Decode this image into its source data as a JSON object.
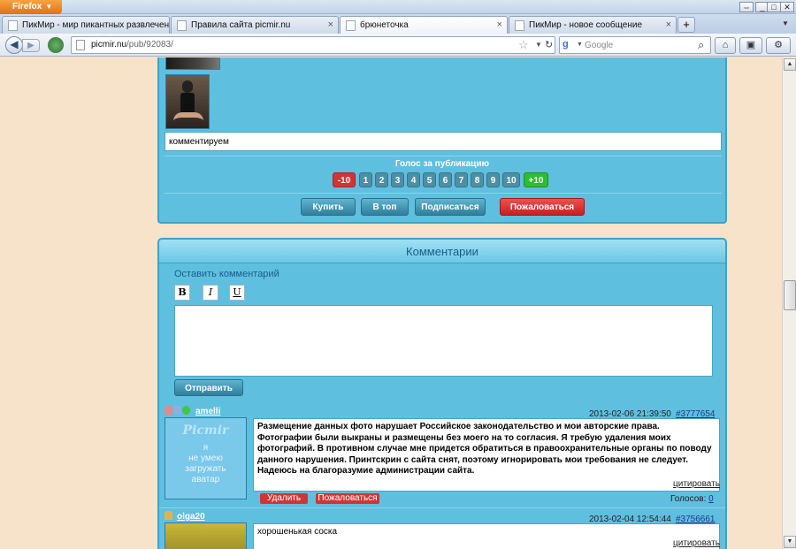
{
  "browser": {
    "menu_label": "Firefox",
    "window_buttons": [
      "⇔",
      "_",
      "□",
      "✕"
    ],
    "tabs": [
      {
        "title": "ПикМир - мир пикантных развлечений!..."
      },
      {
        "title": "Правила сайта picmir.nu"
      },
      {
        "title": "брюнеточка"
      },
      {
        "title": "ПикМир - новое сообщение"
      }
    ],
    "new_tab_label": "+",
    "url_host": "picmir.nu",
    "url_path": "/pub/92083/",
    "search_placeholder": "Google"
  },
  "publication": {
    "comment_value": "комментируем",
    "vote_title": "Голос за публикацию",
    "vote_options": [
      "-10",
      "1",
      "2",
      "3",
      "4",
      "5",
      "6",
      "7",
      "8",
      "9",
      "10",
      "+10"
    ],
    "buttons": {
      "buy": "Купить",
      "to_top": "В топ",
      "subscribe": "Подписаться",
      "report": "Пожаловаться"
    }
  },
  "comments": {
    "header": "Комментарии",
    "leave_label": "Оставить комментарий",
    "format_buttons": {
      "bold": "B",
      "italic": "I",
      "underline": "U"
    },
    "send_label": "Отправить",
    "list": [
      {
        "user": "amelli",
        "date": "2013-02-06 21:39:50",
        "id": "#3777654",
        "avatar_logo": "Picmir",
        "avatar_text_1": "я",
        "avatar_text_2": "не умею",
        "avatar_text_3": "загружать",
        "avatar_text_4": "аватар",
        "text": "Размещение данных фото нарушает Российское законодательство и мои авторские права. Фотографии были выкраны и размещены без моего на то согласия. Я требую удаления моих фотографий. В противном случае мне придется обратиться в правоохранительные органы по поводу данного нарушения. Принтскрин с сайта снят, поэтому игнорировать мои требования не следует. Надеюсь на благоразумие администрации сайта.",
        "cite": "цитировать",
        "delete": "Удалить",
        "report": "Пожаловаться",
        "votes_label": "Голосов:",
        "votes_value": "0"
      },
      {
        "user": "olga20",
        "date": "2013-02-04 12:54:44",
        "id": "#3756661",
        "text": "хорошенькая соска",
        "cite": "цитировать"
      }
    ]
  },
  "colors": {
    "page_bg": "#f6e3c9",
    "panel_bg": "#5fbfdf",
    "panel_border": "#3aa4cc",
    "danger": "#d03535",
    "positive": "#2ebd2e"
  }
}
